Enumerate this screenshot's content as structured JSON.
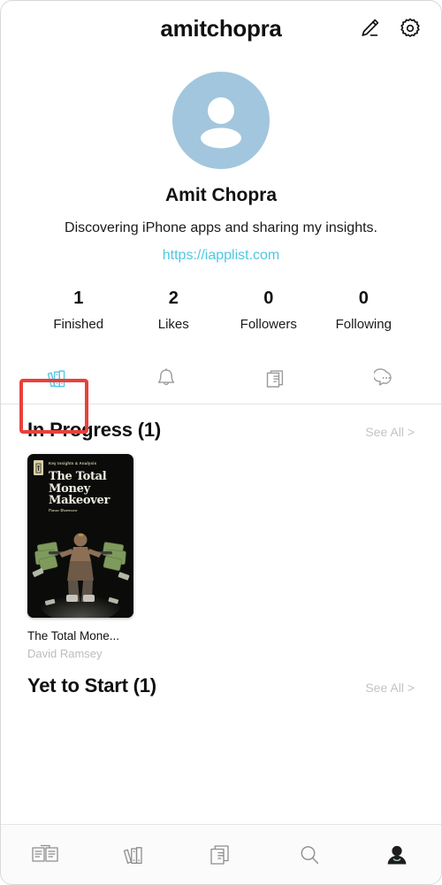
{
  "header": {
    "title": "amitchopra",
    "edit_icon": "pencil-edit-icon",
    "settings_icon": "gear-icon"
  },
  "profile": {
    "avatar_icon": "person-avatar-icon",
    "avatar_color": "#a2c6dd",
    "display_name": "Amit Chopra",
    "bio": "Discovering iPhone apps and sharing my insights.",
    "website": "https://iapplist.com",
    "website_color": "#4ec8e3"
  },
  "stats": [
    {
      "value": "1",
      "label": "Finished"
    },
    {
      "value": "2",
      "label": "Likes"
    },
    {
      "value": "0",
      "label": "Followers"
    },
    {
      "value": "0",
      "label": "Following"
    }
  ],
  "tabs": [
    {
      "icon": "books-shelf-icon",
      "active": true
    },
    {
      "icon": "bell-icon",
      "active": false
    },
    {
      "icon": "documents-icon",
      "active": false
    },
    {
      "icon": "chat-bubble-icon",
      "active": false
    }
  ],
  "tab_highlight_color": "#e8413a",
  "sections": [
    {
      "title": "In Progress (1)",
      "see_all": "See All >",
      "books": [
        {
          "cover_kicker": "Key Insights & Analysis",
          "cover_title": "The Total Money Makeover",
          "cover_author": "Dave Ramsey",
          "title": "The Total Mone...",
          "author": "David Ramsey"
        }
      ]
    },
    {
      "title": "Yet to Start (1)",
      "see_all": "See All >",
      "books": []
    }
  ],
  "bottom_nav": [
    {
      "icon": "open-book-icon",
      "active": false
    },
    {
      "icon": "books-shelf-icon",
      "active": false
    },
    {
      "icon": "documents-icon",
      "active": false
    },
    {
      "icon": "search-icon",
      "active": false
    },
    {
      "icon": "profile-person-icon",
      "active": true
    }
  ]
}
